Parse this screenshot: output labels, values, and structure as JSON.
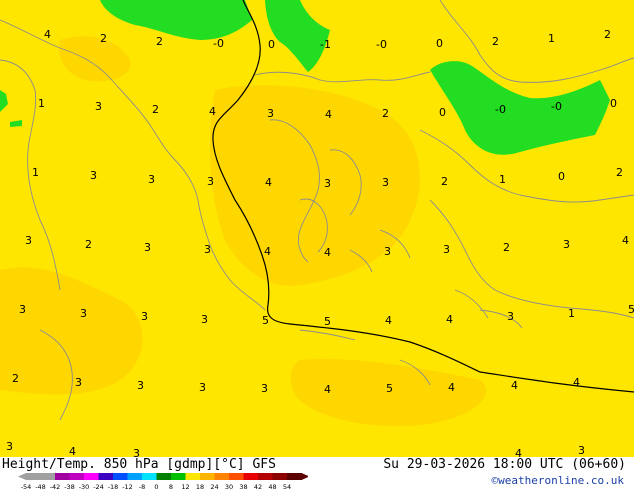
{
  "map": {
    "background_color": "#ffe600",
    "colors": {
      "yellow_bright": "#ffe600",
      "yellow_pale": "#ffd400",
      "green_zero": "#22dd22",
      "coast_line": "#8c8c8c",
      "front_line": "#000000"
    },
    "labels": {
      "v_4a": "4",
      "v_2a": "2",
      "v_2b": "2",
      "v_m0a": "-0",
      "v_0a": "0",
      "v_m1": "-1",
      "v_m0b": "-0",
      "v_0b": "0",
      "v_2c": "2",
      "v_1a": "1",
      "v_2d": "2",
      "v_1b": "1",
      "v_3a": "3",
      "v_2e": "2",
      "v_4b": "4",
      "v_3b": "3",
      "v_4c": "4",
      "v_2f": "2",
      "v_0c": "0",
      "v_m0c": "-0",
      "v_m0d": "-0",
      "v_0d": "0",
      "v_1c": "1",
      "v_3c": "3",
      "v_3d": "3",
      "v_3e": "3",
      "v_4d": "4",
      "v_3f": "3",
      "v_3g": "3",
      "v_2g": "2",
      "v_1d": "1",
      "v_0e": "0",
      "v_2h": "2",
      "v_3h": "3",
      "v_2i": "2",
      "v_3i": "3",
      "v_3j": "3",
      "v_4e": "4",
      "v_4f": "4",
      "v_3k": "3",
      "v_3l": "3",
      "v_2j": "2",
      "v_3m": "3",
      "v_4g": "4",
      "v_3n": "3",
      "v_3o": "3",
      "v_3p": "3",
      "v_3q": "3",
      "v_5a": "5",
      "v_5b": "5",
      "v_4h": "4",
      "v_4i": "4",
      "v_3r": "3",
      "v_1e": "1",
      "v_5c": "5",
      "v_2k": "2",
      "v_3s": "3",
      "v_3t": "3",
      "v_3u": "3",
      "v_3v": "3",
      "v_4j": "4",
      "v_5d": "5",
      "v_4k": "4",
      "v_4l": "4",
      "v_4m": "4",
      "v_3w": "3",
      "v_4n": "4",
      "v_3x": "3",
      "v_4o": "4",
      "v_3y": "3"
    }
  },
  "footer": {
    "title": "Height/Temp. 850 hPa [gdmp][°C] GFS",
    "valid_time": "Su 29-03-2026 18:00 UTC (06+60)",
    "credit": "©weatheronline.co.uk",
    "scale_ticks": [
      "-54",
      "-48",
      "-42",
      "-38",
      "-30",
      "-24",
      "-18",
      "-12",
      "-8",
      "0",
      "8",
      "12",
      "18",
      "24",
      "30",
      "38",
      "42",
      "48",
      "54"
    ],
    "scale_colors": [
      "#a0a0a0",
      "#a0a0a0",
      "#a000a0",
      "#c000c0",
      "#ff00ff",
      "#3c00c0",
      "#0050ff",
      "#00a0ff",
      "#00e0ff",
      "#008000",
      "#00c000",
      "#ffe600",
      "#ffb400",
      "#ff8200",
      "#ff5000",
      "#e60000",
      "#b40000",
      "#8c0000",
      "#5a0000"
    ]
  }
}
